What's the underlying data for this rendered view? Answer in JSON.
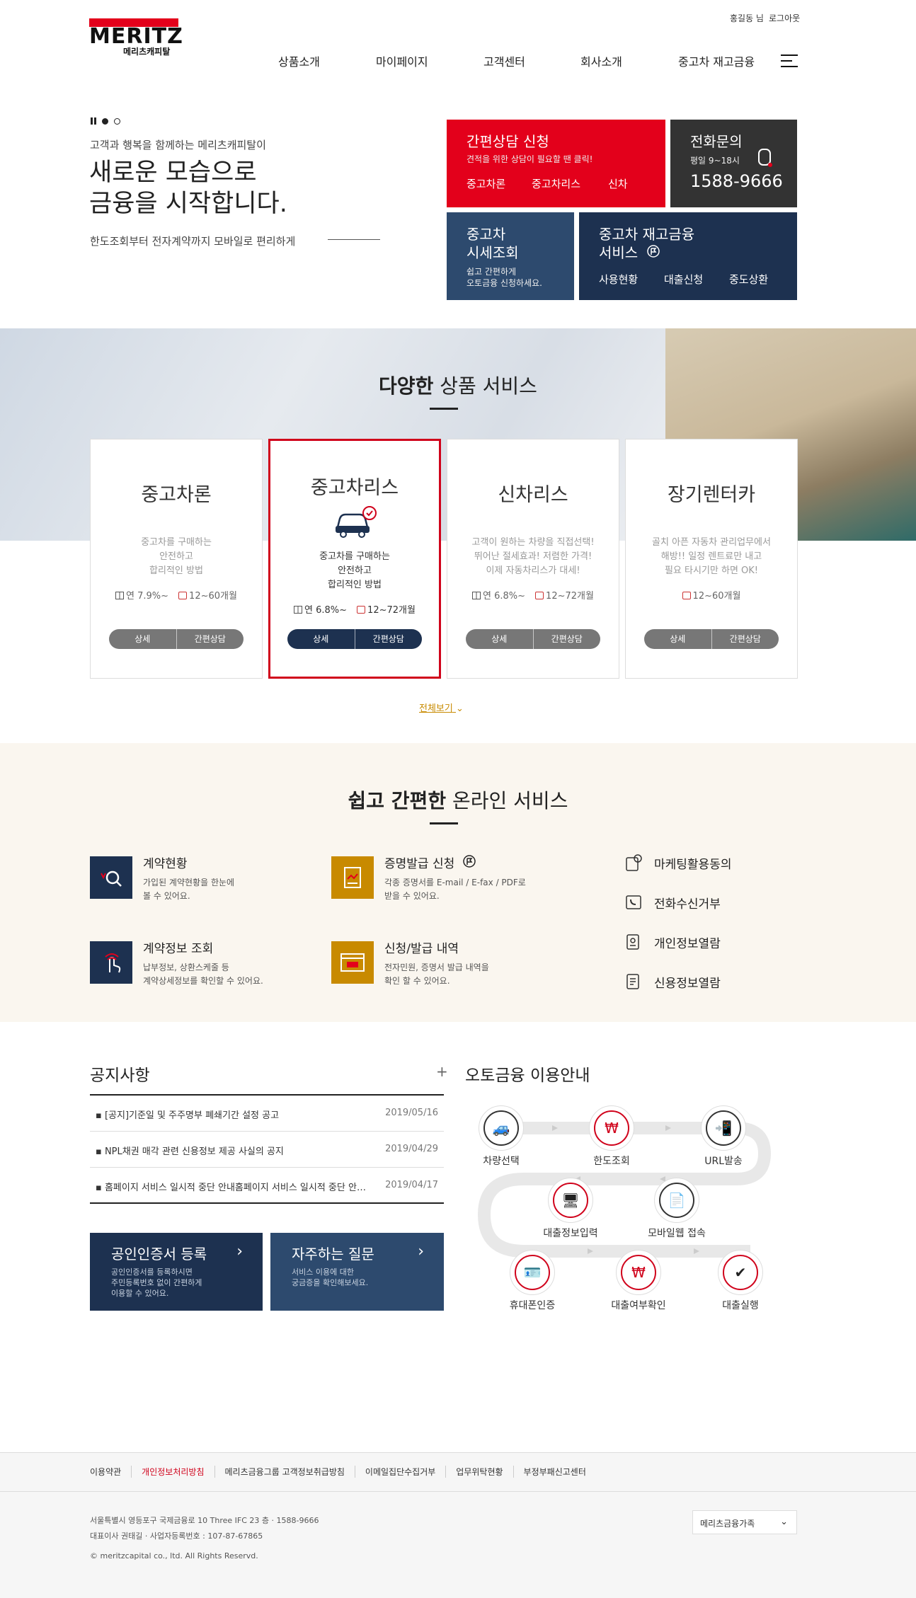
{
  "brand": {
    "logo_main": "MERITZ",
    "logo_sub": "메리츠캐피탈"
  },
  "util": {
    "user": "홍길동 님",
    "logout": "로그아웃"
  },
  "gnb": [
    "상품소개",
    "마이페이지",
    "고객센터",
    "회사소개",
    "중고차 재고금융"
  ],
  "hero": {
    "subtitle": "고객과 행복을 함께하는 메리츠캐피탈이",
    "title": "새로운 모습으로\n금융을 시작합니다.",
    "desc": "한도조회부터 전자계약까지 모바일로 편리하게"
  },
  "tiles": {
    "consult": {
      "title": "간편상담 신청",
      "desc": "견적을 위한 상담이 필요할 땐 클릭!",
      "links": [
        "중고차론",
        "중고차리스",
        "신차"
      ]
    },
    "phone": {
      "title": "전화문의",
      "hours": "평일 9~18시",
      "number": "1588-9666"
    },
    "price": {
      "title": "중고차\n시세조회",
      "desc": "쉽고 간편하게\n오토금융 신청하세요."
    },
    "inventory": {
      "title": "중고차 재고금융\n서비스",
      "links": [
        "사용현황",
        "대출신청",
        "중도상환"
      ]
    }
  },
  "products": {
    "title_bold": "다양한",
    "title_rest": " 상품 서비스",
    "cards": [
      {
        "name": "중고차론",
        "desc": "중고차를 구매하는\n안전하고\n합리적인 방법",
        "rate": "연 7.9%~",
        "term": "12~60개월",
        "btn_detail": "상세",
        "btn_consult": "간편상담"
      },
      {
        "name": "중고차리스",
        "desc": "중고차를 구매하는\n안전하고\n합리적인 방법",
        "rate": "연 6.8%~",
        "term": "12~72개월",
        "btn_detail": "상세",
        "btn_consult": "간편상담"
      },
      {
        "name": "신차리스",
        "desc": "고객이 원하는 차량을 직접선택!\n뛰어난 절세효과! 저렴한 가격!\n이제 자동차리스가 대세!",
        "rate": "연 6.8%~",
        "term": "12~72개월",
        "btn_detail": "상세",
        "btn_consult": "간편상담"
      },
      {
        "name": "장기렌터카",
        "desc": "골치 아픈 자동차 관리업무에서\n해방!! 일정 렌트료만 내고\n필요 타시기만 하면 OK!",
        "rate": "",
        "term": "12~60개월",
        "btn_detail": "상세",
        "btn_consult": "간편상담"
      }
    ],
    "more": "전체보기"
  },
  "online": {
    "title_bold": "쉽고 간편한",
    "title_rest": " 온라인 서비스",
    "items": [
      {
        "title": "계약현황",
        "desc": "가입된 계약현황을 한눈에\n볼 수 있어요."
      },
      {
        "title": "증명발급 신청",
        "desc": "각종 증명서를 E-mail / E-fax / PDF로\n받을 수 있어요."
      },
      {
        "title": "계약정보 조회",
        "desc": "납부정보, 상환스케줄 등\n계약상세정보를 확인할 수 있어요."
      },
      {
        "title": "신청/발급 내역",
        "desc": "전자민원, 증명서 발급 내역을\n확인 할 수 있어요."
      }
    ],
    "right": [
      "마케팅활용동의",
      "전화수신거부",
      "개인정보열람",
      "신용정보열람"
    ]
  },
  "notice": {
    "title": "공지사항",
    "plus": "+",
    "rows": [
      {
        "title": "[공지]기준일 및 주주명부 폐쇄기간 설정 공고",
        "date": "2019/05/16"
      },
      {
        "title": "NPL채권 매각 관련 신용정보 제공 사실의 공지",
        "date": "2019/04/29"
      },
      {
        "title": "홈페이지 서비스 일시적 중단 안내홈페이지 서비스 일시적 중단 안내홈페이지",
        "date": "2019/04/17"
      }
    ]
  },
  "boxes": [
    {
      "title": "공인인증서 등록",
      "desc": "공인인증서를 등록하시면\n주민등록번호 없이 간편하게\n이용할 수 있어요.",
      "arrow": "›"
    },
    {
      "title": "자주하는 질문",
      "desc": "서비스 이용에 대한\n궁금증을 확인해보세요.",
      "arrow": "›"
    }
  ],
  "guide": {
    "title": "오토금융 이용안내",
    "steps": [
      "차량선택",
      "한도조회",
      "URL발송",
      "모바일웹 접속",
      "대출정보입력",
      "휴대폰인증",
      "대출여부확인",
      "대출실행"
    ]
  },
  "footer": {
    "links": [
      "이용약관",
      "개인정보처리방침",
      "메리츠금융그룹 고객정보취급방침",
      "이메일집단수집거부",
      "업무위탁현황",
      "부정부패신고센터"
    ],
    "address": "서울특별시 영등포구 국제금융로 10 Three IFC 23 층 · 1588-9666",
    "ceo": "대표이사 권태길 · 사업자등록번호 : 107-87-67865",
    "copy": "© meritzcapital co., ltd. All Rights Reservd.",
    "family": "메리츠금융가족"
  },
  "colors": {
    "red": "#e3001b",
    "navy": "#1d3150",
    "navy_light": "#2d4a6e",
    "gold": "#c88a00"
  }
}
